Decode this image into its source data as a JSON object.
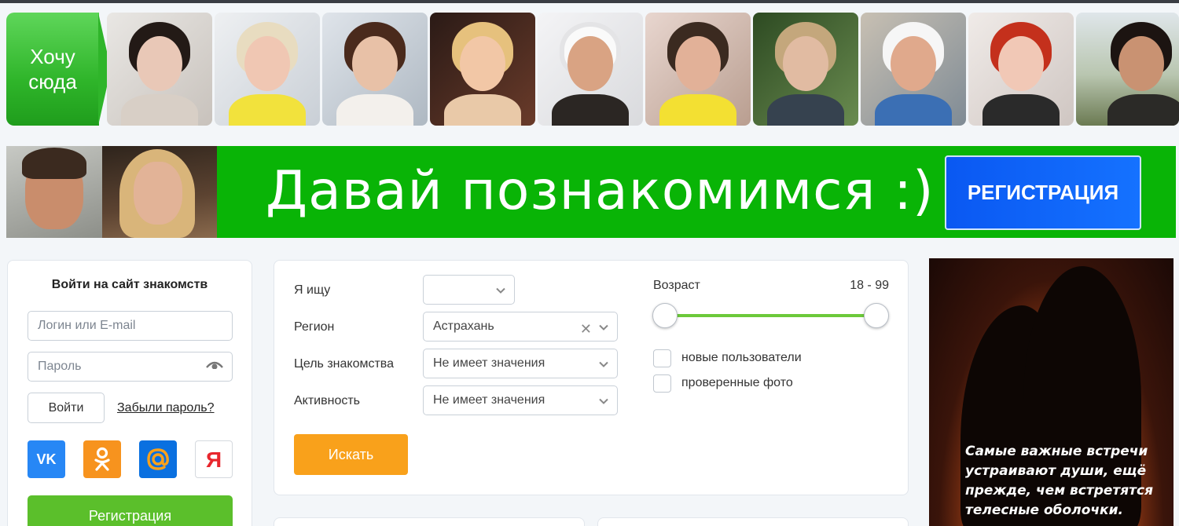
{
  "strip": {
    "want_text_1": "Хочу",
    "want_text_2": "сюда",
    "thumb_count": 10
  },
  "banner": {
    "headline": "Давай познакомимся :)",
    "register_button": "РЕГИСТРАЦИЯ"
  },
  "login": {
    "title": "Войти на сайт знакомств",
    "login_placeholder": "Логин или E-mail",
    "password_placeholder": "Пароль",
    "login_button": "Войти",
    "forgot_link": "Забыли пароль?",
    "socials": [
      "vk-icon",
      "odnoklassniki-icon",
      "mail-icon",
      "yandex-icon"
    ],
    "register_button": "Регистрация"
  },
  "search": {
    "looking_label": "Я ищу",
    "looking_value": "",
    "region_label": "Регион",
    "region_value": "Астрахань",
    "goal_label": "Цель знакомства",
    "goal_value": "Не имеет значения",
    "activity_label": "Активность",
    "activity_value": "Не имеет значения",
    "search_button": "Искать",
    "age_label": "Возраст",
    "age_value": "18 - 99",
    "age_min": 18,
    "age_max": 99,
    "new_users_label": "новые пользователи",
    "verified_photo_label": "проверенные фото"
  },
  "ad": {
    "line1": "Самые важные встречи",
    "line2": "устраивают души, ещё",
    "line3": "прежде, чем встретятся",
    "line4": "телесные оболочки."
  },
  "colors": {
    "accent_green": "#09b406",
    "register_blue": "#0a58f2",
    "search_orange": "#f9a11b",
    "slider_green": "#6cc93a"
  }
}
